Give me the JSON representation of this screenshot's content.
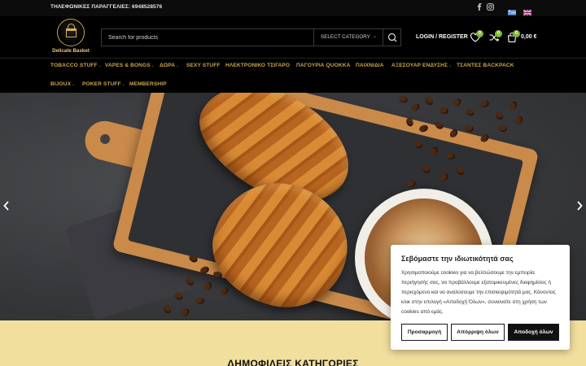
{
  "topbar": {
    "phone": "ΤΗΛΕΦΩΝΙΚΕΣ ΠΑΡΑΓΓΕΛΙΕΣ: 6948528576",
    "social": [
      "facebook-icon",
      "instagram-icon"
    ],
    "languages": [
      "greek-flag-icon",
      "english-flag-icon"
    ]
  },
  "header": {
    "logo_text": "Delicate Basket",
    "search_placeholder": "Search for products",
    "category_label": "SELECT CATEGORY",
    "login_label": "LOGIN / REGISTER",
    "wishlist_count": "0",
    "compare_count": "0",
    "cart_count": "0",
    "cart_total": "0,00 €"
  },
  "nav": {
    "items": [
      {
        "label": "TOBACCO STUFF",
        "dropdown": true
      },
      {
        "label": "VAPES & BONGS",
        "dropdown": true
      },
      {
        "label": "ΔΩΡΑ",
        "dropdown": true
      },
      {
        "label": "SEXY STUFF",
        "dropdown": false
      },
      {
        "label": "ΗΛΕΚΤΡΟΝΙΚΟ ΤΣΙΓΑΡΟ",
        "dropdown": false
      },
      {
        "label": "ΠΑΓΟΥΡΙΑ QUOKKA",
        "dropdown": false
      },
      {
        "label": "ΠΑΙΧΝΙΔΙΑ",
        "dropdown": false
      },
      {
        "label": "ΑΞΕΣΟΥΑΡ ΕΝΔΥΣΗΣ",
        "dropdown": true
      },
      {
        "label": "ΤΣΑΝΤΕΣ BACKPACK",
        "dropdown": false
      },
      {
        "label": "BIJOUX",
        "dropdown": true
      },
      {
        "label": "POKER STUFF",
        "dropdown": true
      },
      {
        "label": "MEMBERSHIP",
        "dropdown": false
      }
    ]
  },
  "hero": {
    "prev_icon": "chevron-left-icon",
    "next_icon": "chevron-right-icon"
  },
  "section": {
    "heading": "ΔΗΜΟΦΙΛΕΙΣ ΚΑΤΗΓΟΡΙΕΣ"
  },
  "cookie": {
    "title": "Σεβόμαστε την ιδιωτικότητά σας",
    "text": "Χρησιμοποιούμε cookies για να βελτιώσουμε την εμπειρία περιήγησής σας, να προβάλλουμε εξατομικευμένες διαφημίσεις ή περιεχόμενο και να αναλύσουμε την επισκεψιμότητά μας. Κάνοντας κλικ στην επιλογή «Αποδοχή Όλων», συναινείτε στη χρήση των cookies από εμάς.",
    "customize_label": "Προσαρμογή",
    "reject_label": "Απόρριψη όλων",
    "accept_label": "Αποδοχή όλων"
  },
  "colors": {
    "accent_gold": "#c9a54a",
    "badge_green": "#83b735",
    "section_bg": "#f1df9e"
  }
}
